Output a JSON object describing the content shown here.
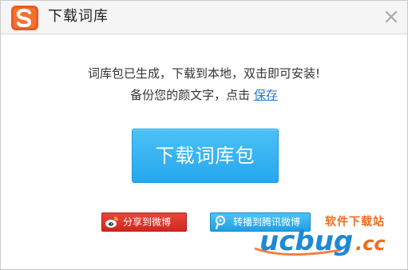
{
  "window": {
    "title": "下载词库",
    "logo_icon": "sogou-input-logo",
    "close_icon": "close-icon",
    "accent_color": "#29abf0"
  },
  "message": {
    "line1": "词库包已生成，下载到本地，双击即可安装!",
    "line2_prefix": "备份您的颜文字，点击 ",
    "save_link": "保存"
  },
  "actions": {
    "download_label": "下载词库包"
  },
  "share": {
    "weibo_label": "分享到微博",
    "tencent_label": "转播到腾讯微博",
    "weibo_color": "#d9322a",
    "tencent_color": "#29abf0"
  },
  "watermark": {
    "site_label": "软件下载站",
    "brand": "ucbug",
    "tld": ".cc"
  }
}
